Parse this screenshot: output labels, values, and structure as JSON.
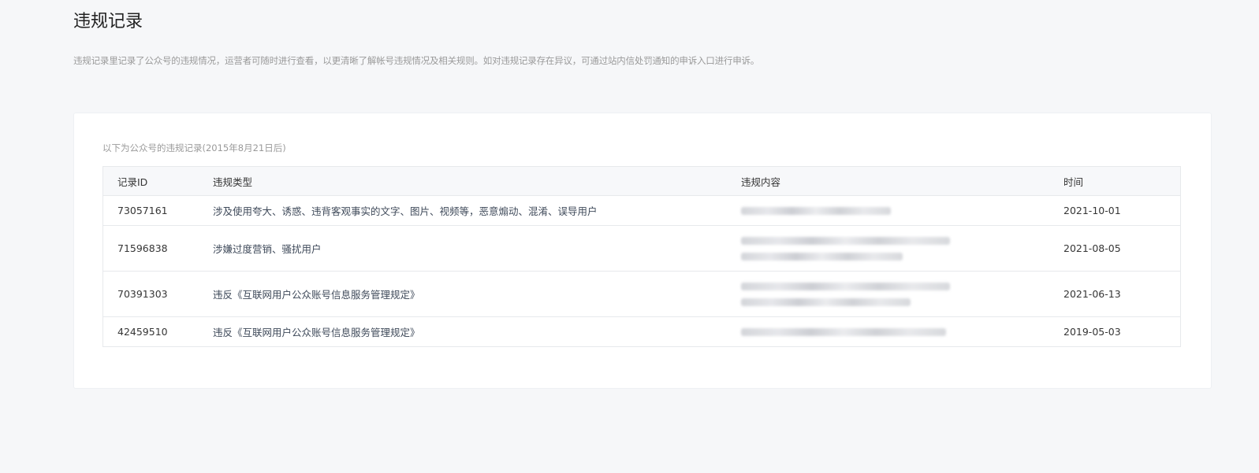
{
  "page": {
    "title": "违规记录",
    "description": "违规记录里记录了公众号的违规情况，运营者可随时进行查看，以更清晰了解帐号违规情况及相关规则。如对违规记录存在异议，可通过站内信处罚通知的申诉入口进行申诉。"
  },
  "records": {
    "caption": "以下为公众号的违规记录(2015年8月21日后)",
    "columns": {
      "id": "记录ID",
      "type": "违规类型",
      "content": "违规内容",
      "time": "时间"
    },
    "rows": [
      {
        "id": "73057161",
        "type": "涉及使用夸大、诱惑、违背客观事实的文字、图片、视频等，恶意煽动、混淆、误导用户",
        "content_state": "blurred",
        "time": "2021-10-01"
      },
      {
        "id": "71596838",
        "type": "涉嫌过度营销、骚扰用户",
        "content_state": "blurred",
        "time": "2021-08-05"
      },
      {
        "id": "70391303",
        "type": "违反《互联网用户公众账号信息服务管理规定》",
        "content_state": "blurred",
        "time": "2021-06-13"
      },
      {
        "id": "42459510",
        "type": "违反《互联网用户公众账号信息服务管理规定》",
        "content_state": "blurred",
        "time": "2019-05-03"
      }
    ]
  },
  "colors": {
    "page_bg": "#f6f7f9",
    "card_bg": "#ffffff",
    "border": "#e7e9ec",
    "muted_text": "#9a9a9a"
  }
}
